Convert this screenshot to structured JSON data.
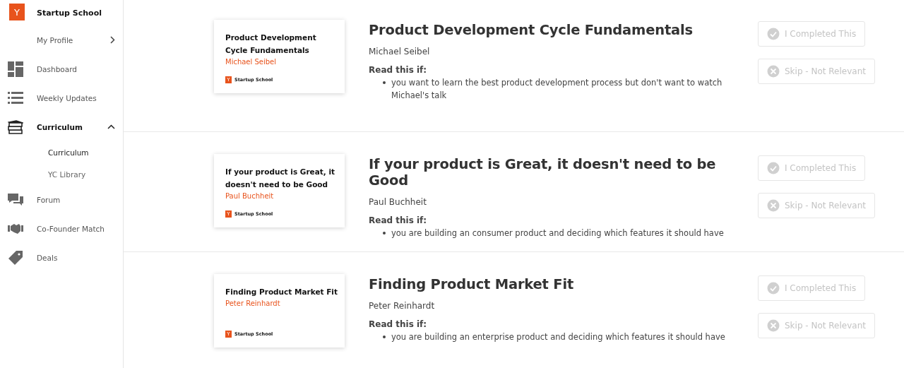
{
  "sidebar": {
    "brand": {
      "logo": "Y",
      "name": "Startup School"
    },
    "items": [
      {
        "label": "My Profile",
        "selected": false,
        "kind": "link"
      },
      {
        "label": "Dashboard",
        "selected": false,
        "kind": "dashboard"
      },
      {
        "label": "Weekly Updates",
        "selected": false,
        "kind": "updates"
      },
      {
        "label": "Curriculum",
        "selected": true,
        "kind": "books",
        "expanded": true,
        "children": [
          {
            "label": "Curriculum",
            "selected": true
          },
          {
            "label": "YC Library",
            "selected": false
          }
        ]
      },
      {
        "label": "Forum",
        "selected": false,
        "kind": "forum"
      },
      {
        "label": "Co-Founder Match",
        "selected": false,
        "kind": "handshake"
      },
      {
        "label": "Deals",
        "selected": false,
        "kind": "tag"
      }
    ]
  },
  "lessons": [
    {
      "card": {
        "title": "Product Development Cycle Fundamentals",
        "author": "Michael Seibel",
        "logo": "Y",
        "brand": "Startup School"
      },
      "title": "Product Development Cycle Fundamentals",
      "author": "Michael Seibel",
      "read_label": "Read this if:",
      "reasons": [
        "you want to learn the best product development process but don't want to watch Michael's talk"
      ],
      "buttons": [
        {
          "label": "I Completed This",
          "kind": "complete",
          "disabled": true
        },
        {
          "label": "Skip - Not Relevant",
          "kind": "skip",
          "disabled": true
        }
      ]
    },
    {
      "card": {
        "title": "If your product is Great, it doesn't need to be Good",
        "author": "Paul Buchheit",
        "logo": "Y",
        "brand": "Startup School"
      },
      "title": "If your product is Great, it doesn't need to be Good",
      "author": "Paul Buchheit",
      "read_label": "Read this if:",
      "reasons": [
        "you are building an consumer product and deciding which features it should have"
      ],
      "buttons": [
        {
          "label": "I Completed This",
          "kind": "complete",
          "disabled": true
        },
        {
          "label": "Skip - Not Relevant",
          "kind": "skip",
          "disabled": true
        }
      ]
    },
    {
      "card": {
        "title": "Finding Product Market Fit",
        "author": "Peter Reinhardt",
        "logo": "Y",
        "brand": "Startup School"
      },
      "title": "Finding Product Market Fit",
      "author": "Peter Reinhardt",
      "read_label": "Read this if:",
      "reasons": [
        "you are building an enterprise product and deciding which features it should have"
      ],
      "buttons": [
        {
          "label": "I Completed This",
          "kind": "complete",
          "disabled": true
        },
        {
          "label": "Skip - Not Relevant",
          "kind": "skip",
          "disabled": true
        }
      ]
    }
  ]
}
